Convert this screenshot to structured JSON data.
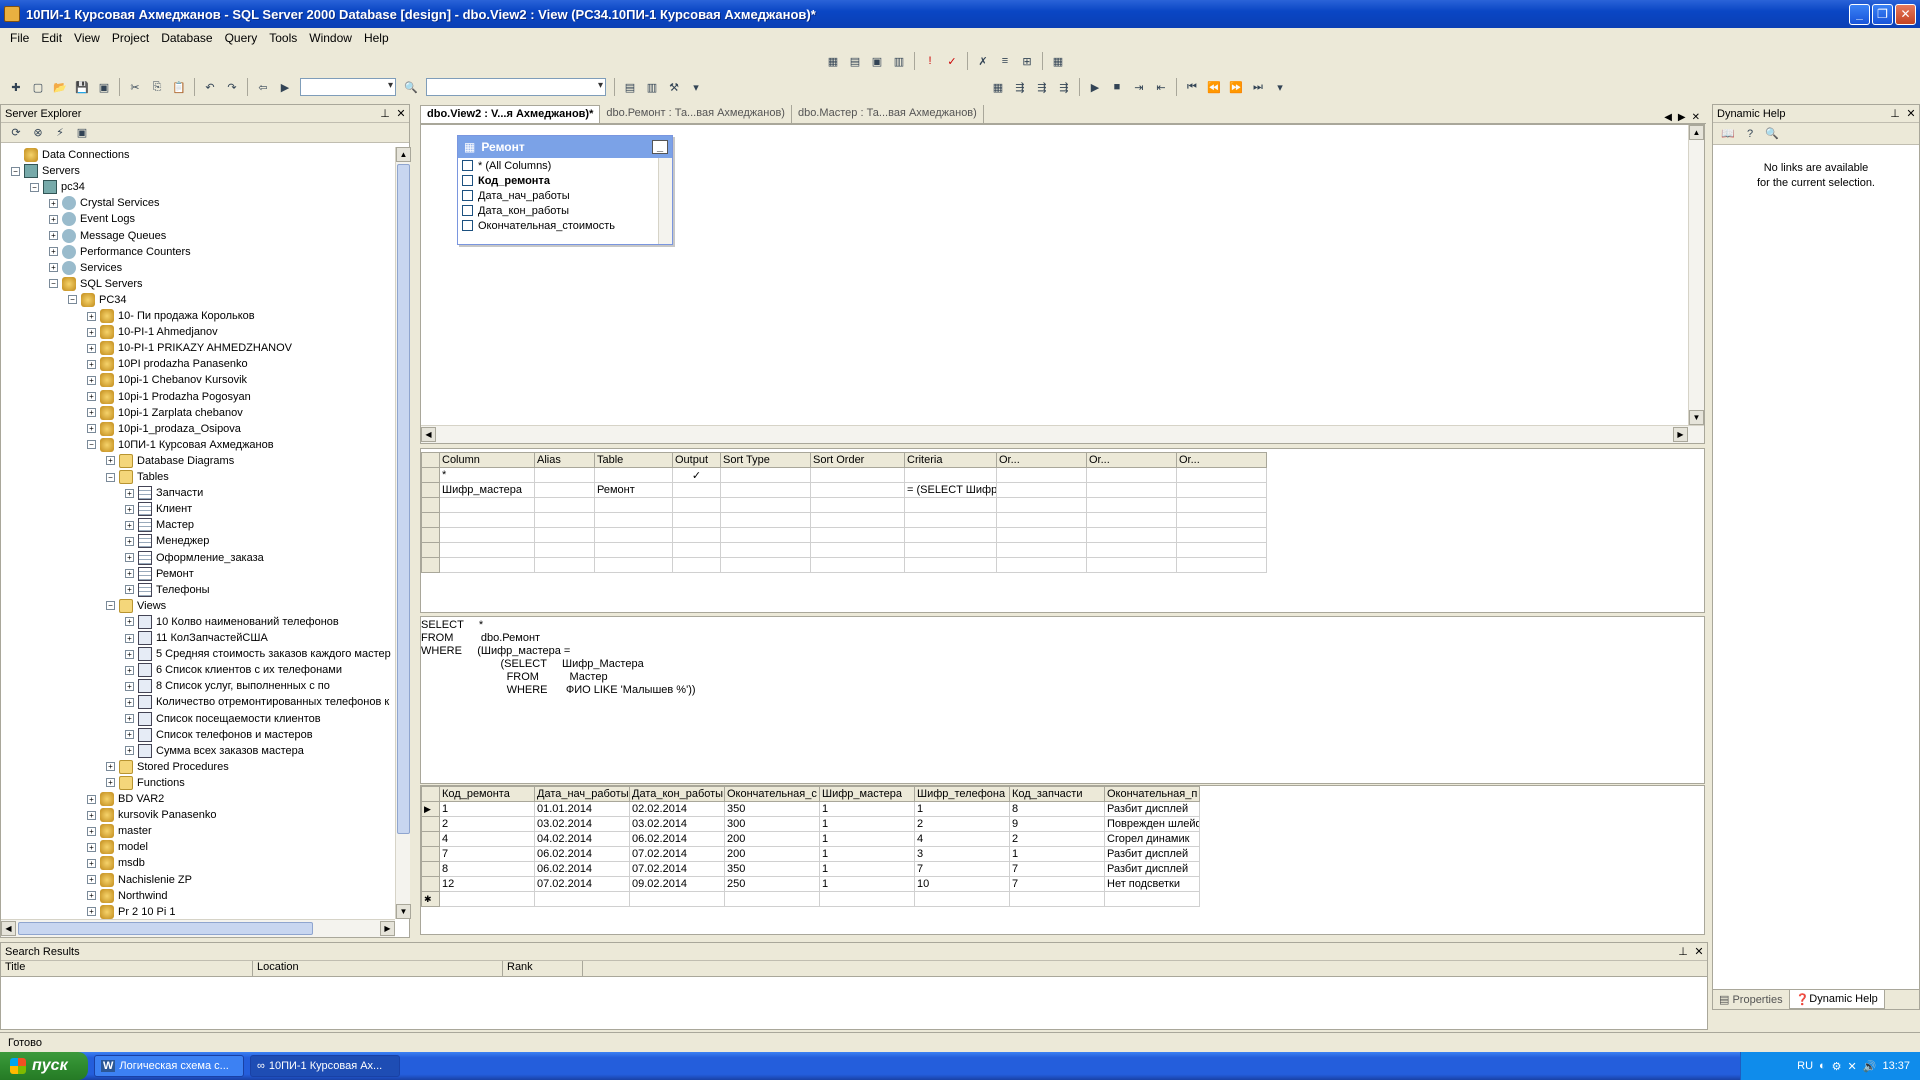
{
  "window": {
    "title": "10ПИ-1 Курсовая Ахмеджанов - SQL Server 2000 Database [design] - dbo.View2 : View (PC34.10ПИ-1 Курсовая Ахмеджанов)*"
  },
  "menu": [
    "File",
    "Edit",
    "View",
    "Project",
    "Database",
    "Query",
    "Tools",
    "Window",
    "Help"
  ],
  "server_explorer": {
    "title": "Server Explorer",
    "tree": [
      {
        "label": "Data Connections",
        "level": 0,
        "exp": "",
        "icon": "db"
      },
      {
        "label": "Servers",
        "level": 0,
        "exp": "-",
        "icon": "server"
      },
      {
        "label": "pc34",
        "level": 1,
        "exp": "-",
        "icon": "server"
      },
      {
        "label": "Crystal Services",
        "level": 2,
        "exp": "+",
        "icon": "misc"
      },
      {
        "label": "Event Logs",
        "level": 2,
        "exp": "+",
        "icon": "misc"
      },
      {
        "label": "Message Queues",
        "level": 2,
        "exp": "+",
        "icon": "misc"
      },
      {
        "label": "Performance Counters",
        "level": 2,
        "exp": "+",
        "icon": "misc"
      },
      {
        "label": "Services",
        "level": 2,
        "exp": "+",
        "icon": "misc"
      },
      {
        "label": "SQL Servers",
        "level": 2,
        "exp": "-",
        "icon": "db"
      },
      {
        "label": "PC34",
        "level": 3,
        "exp": "-",
        "icon": "db"
      },
      {
        "label": "10- Пи продажа Корольков",
        "level": 4,
        "exp": "+",
        "icon": "db"
      },
      {
        "label": "10-PI-1 Ahmedjanov",
        "level": 4,
        "exp": "+",
        "icon": "db"
      },
      {
        "label": "10-PI-1 PRIKAZY AHMEDZHANOV",
        "level": 4,
        "exp": "+",
        "icon": "db"
      },
      {
        "label": "10PI prodazha Panasenko",
        "level": 4,
        "exp": "+",
        "icon": "db"
      },
      {
        "label": "10pi-1 Chebanov Kursovik",
        "level": 4,
        "exp": "+",
        "icon": "db"
      },
      {
        "label": "10pi-1 Prodazha Pogosyan",
        "level": 4,
        "exp": "+",
        "icon": "db"
      },
      {
        "label": "10pi-1 Zarplata chebanov",
        "level": 4,
        "exp": "+",
        "icon": "db"
      },
      {
        "label": "10pi-1_prodaza_Osipova",
        "level": 4,
        "exp": "+",
        "icon": "db"
      },
      {
        "label": "10ПИ-1 Курсовая Ахмеджанов",
        "level": 4,
        "exp": "-",
        "icon": "db"
      },
      {
        "label": "Database Diagrams",
        "level": 5,
        "exp": "+",
        "icon": "folder"
      },
      {
        "label": "Tables",
        "level": 5,
        "exp": "-",
        "icon": "folder"
      },
      {
        "label": "Запчасти",
        "level": 6,
        "exp": "+",
        "icon": "table"
      },
      {
        "label": "Клиент",
        "level": 6,
        "exp": "+",
        "icon": "table"
      },
      {
        "label": "Мастер",
        "level": 6,
        "exp": "+",
        "icon": "table"
      },
      {
        "label": "Менеджер",
        "level": 6,
        "exp": "+",
        "icon": "table"
      },
      {
        "label": "Оформление_заказа",
        "level": 6,
        "exp": "+",
        "icon": "table"
      },
      {
        "label": "Ремонт",
        "level": 6,
        "exp": "+",
        "icon": "table"
      },
      {
        "label": "Телефоны",
        "level": 6,
        "exp": "+",
        "icon": "table"
      },
      {
        "label": "Views",
        "level": 5,
        "exp": "-",
        "icon": "folder"
      },
      {
        "label": "10 Колво наименований телефонов",
        "level": 6,
        "exp": "+",
        "icon": "view"
      },
      {
        "label": "11 КолЗапчастейСША",
        "level": 6,
        "exp": "+",
        "icon": "view"
      },
      {
        "label": "5 Средняя стоимость заказов каждого мастер",
        "level": 6,
        "exp": "+",
        "icon": "view"
      },
      {
        "label": "6 Список клиентов с их телефонами",
        "level": 6,
        "exp": "+",
        "icon": "view"
      },
      {
        "label": "8 Список услуг, выполненных  с по",
        "level": 6,
        "exp": "+",
        "icon": "view"
      },
      {
        "label": "Количество отремонтированных телефонов к",
        "level": 6,
        "exp": "+",
        "icon": "view"
      },
      {
        "label": "Список посещаемости клиентов",
        "level": 6,
        "exp": "+",
        "icon": "view"
      },
      {
        "label": "Список телефонов и мастеров",
        "level": 6,
        "exp": "+",
        "icon": "view"
      },
      {
        "label": "Сумма всех заказов мастера",
        "level": 6,
        "exp": "+",
        "icon": "view"
      },
      {
        "label": "Stored Procedures",
        "level": 5,
        "exp": "+",
        "icon": "folder"
      },
      {
        "label": "Functions",
        "level": 5,
        "exp": "+",
        "icon": "folder"
      },
      {
        "label": "BD VAR2",
        "level": 4,
        "exp": "+",
        "icon": "db"
      },
      {
        "label": "kursovik Panasenko",
        "level": 4,
        "exp": "+",
        "icon": "db"
      },
      {
        "label": "master",
        "level": 4,
        "exp": "+",
        "icon": "db"
      },
      {
        "label": "model",
        "level": 4,
        "exp": "+",
        "icon": "db"
      },
      {
        "label": "msdb",
        "level": 4,
        "exp": "+",
        "icon": "db"
      },
      {
        "label": "Nachislenie ZP",
        "level": 4,
        "exp": "+",
        "icon": "db"
      },
      {
        "label": "Northwind",
        "level": 4,
        "exp": "+",
        "icon": "db"
      },
      {
        "label": "Pr 2 10 Pi 1",
        "level": 4,
        "exp": "+",
        "icon": "db"
      }
    ]
  },
  "doc_tabs": [
    {
      "label": "dbo.View2 : V...я Ахмеджанов)*",
      "active": true
    },
    {
      "label": "dbo.Ремонт : Та...вая Ахмеджанов)",
      "active": false
    },
    {
      "label": "dbo.Мастер : Та...вая Ахмеджанов)",
      "active": false
    }
  ],
  "diagram": {
    "table_name": "Ремонт",
    "fields": [
      "* (All Columns)",
      "Код_ремонта",
      "Дата_нач_работы",
      "Дата_кон_работы",
      "Окончательная_стоимость"
    ]
  },
  "grid": {
    "headers": [
      "Column",
      "Alias",
      "Table",
      "Output",
      "Sort Type",
      "Sort Order",
      "Criteria",
      "Or...",
      "Or...",
      "Or..."
    ],
    "rows": [
      [
        "*",
        "",
        "",
        "✓",
        "",
        "",
        "",
        "",
        "",
        ""
      ],
      [
        "Шифр_мастера",
        "",
        "Ремонт",
        "",
        "",
        "",
        "= (SELECT Шифр_",
        "",
        "",
        ""
      ],
      [
        "",
        "",
        "",
        "",
        "",
        "",
        "",
        "",
        "",
        ""
      ],
      [
        "",
        "",
        "",
        "",
        "",
        "",
        "",
        "",
        "",
        ""
      ],
      [
        "",
        "",
        "",
        "",
        "",
        "",
        "",
        "",
        "",
        ""
      ],
      [
        "",
        "",
        "",
        "",
        "",
        "",
        "",
        "",
        "",
        ""
      ],
      [
        "",
        "",
        "",
        "",
        "",
        "",
        "",
        "",
        "",
        ""
      ]
    ]
  },
  "sql": [
    "SELECT     *",
    "FROM         dbo.Ремонт",
    "WHERE     (Шифр_мастера =",
    "                          (SELECT     Шифр_Мастера",
    "                            FROM          Мастер",
    "                            WHERE      ФИО LIKE 'Малышев %'))"
  ],
  "results": {
    "headers": [
      "Код_ремонта",
      "Дата_нач_работы",
      "Дата_кон_работы",
      "Окончательная_с",
      "Шифр_мастера",
      "Шифр_телефона",
      "Код_запчасти",
      "Окончательная_п"
    ],
    "rows": [
      [
        "1",
        "01.01.2014",
        "02.02.2014",
        "350",
        "1",
        "1",
        "8",
        "Разбит дисплей"
      ],
      [
        "2",
        "03.02.2014",
        "03.02.2014",
        "300",
        "1",
        "2",
        "9",
        "Поврежден шлейф"
      ],
      [
        "4",
        "04.02.2014",
        "06.02.2014",
        "200",
        "1",
        "4",
        "2",
        "Сгорел динамик"
      ],
      [
        "7",
        "06.02.2014",
        "07.02.2014",
        "200",
        "1",
        "3",
        "1",
        "Разбит дисплей"
      ],
      [
        "8",
        "06.02.2014",
        "07.02.2014",
        "350",
        "1",
        "7",
        "7",
        "Разбит дисплей"
      ],
      [
        "12",
        "07.02.2014",
        "09.02.2014",
        "250",
        "1",
        "10",
        "7",
        "Нет подсветки"
      ]
    ]
  },
  "dynamic_help": {
    "title": "Dynamic Help",
    "message_line1": "No links are available",
    "message_line2": "for the current selection.",
    "tab_properties": "Properties",
    "tab_dynamic_help": "Dynamic Help"
  },
  "search_results": {
    "title": "Search Results",
    "col_title": "Title",
    "col_location": "Location",
    "col_rank": "Rank"
  },
  "status": "Готово",
  "taskbar": {
    "start": "пуск",
    "items": [
      "Логическая схема с...",
      "10ПИ-1 Курсовая Ах..."
    ],
    "lang": "RU",
    "time": "13:37"
  }
}
